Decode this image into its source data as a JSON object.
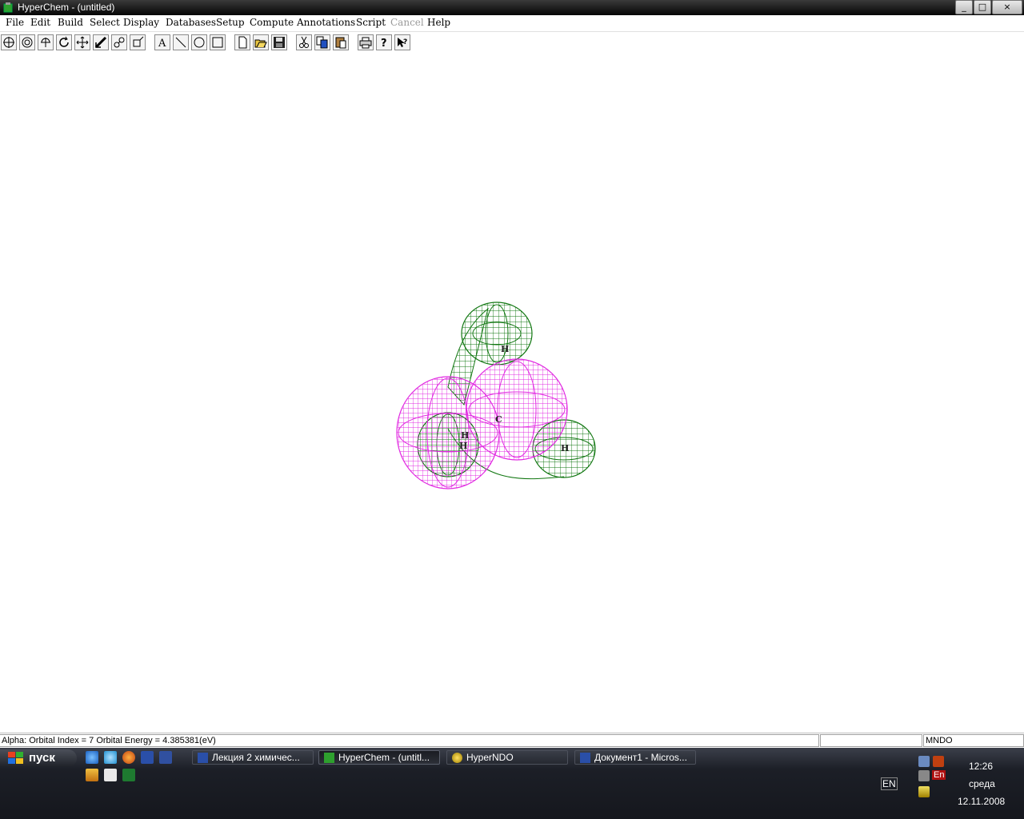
{
  "window": {
    "title": "HyperChem - (untitled)",
    "controls": [
      "_",
      "□",
      "×"
    ]
  },
  "menu": [
    "File",
    "Edit",
    "Build",
    "Select",
    "Display",
    "Databases",
    "Setup",
    "Compute",
    "Annotations",
    "Script",
    "Cancel",
    "Help"
  ],
  "toolbar": [
    "draw-tool",
    "select-tool",
    "rotate-xy-tool",
    "rotate-z-tool",
    "translate-xy-tool",
    "translate-z-tool",
    "zoom-tool",
    "clip-tool",
    "text-tool",
    "line-tool",
    "ellipse-tool",
    "rectangle-tool",
    "new-file",
    "open-file",
    "save-file",
    "cut",
    "copy",
    "paste",
    "print",
    "help",
    "context-help"
  ],
  "molecule": {
    "atom_labels": [
      "H",
      "C",
      "H",
      "H",
      "H"
    ]
  },
  "status": {
    "message": "Alpha: Orbital Index = 7 Orbital Energy = 4.385381(eV)",
    "cell2": "",
    "method": "MNDO"
  },
  "taskbar": {
    "start_label": "пуск",
    "quicklaunch_top": [
      "ie-icon",
      "browser-icon",
      "firefox-icon",
      "word-icon",
      "save-icon"
    ],
    "quicklaunch_bottom": [
      "tool-icon",
      "app-icon",
      "excel-icon"
    ],
    "tasks": [
      {
        "label": "Лекция 2 химичес...",
        "icon": "word-doc-icon"
      },
      {
        "label": "HyperChem - (untitl...",
        "icon": "hyperchem-icon"
      },
      {
        "label": "HyperNDO",
        "icon": "hyperndo-icon"
      },
      {
        "label": "Документ1 - Micros...",
        "icon": "word-doc-icon"
      }
    ],
    "lang": "EN",
    "tray_lang": "En",
    "time": "12:26",
    "day": "среда",
    "date": "12.11.2008"
  },
  "colors": {
    "green_orbital": "#117711",
    "magenta_orbital": "#e020e0",
    "title_bar": "#1a1a1a",
    "taskbar": "#1c1f27"
  }
}
